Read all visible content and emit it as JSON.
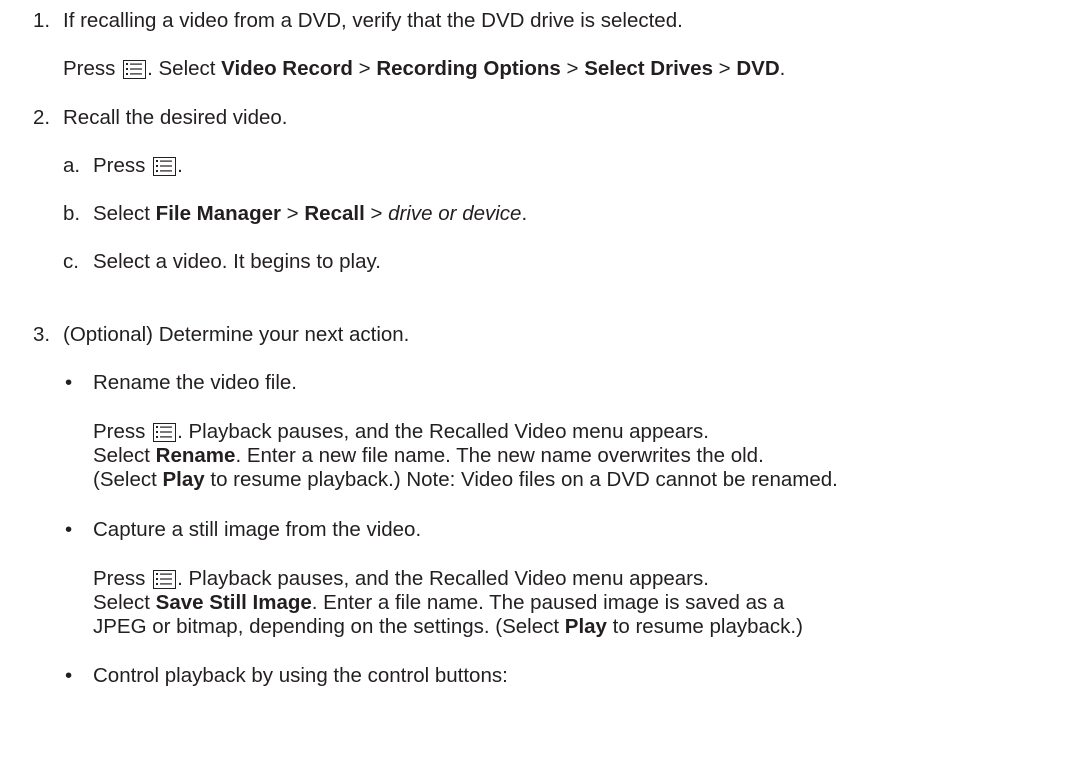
{
  "steps": [
    {
      "number": "1.",
      "text": "If recalling a video from a DVD, verify that the DVD drive is selected.",
      "body": {
        "press": "Press",
        "after_icon": ". Select ",
        "path": [
          "Video Record",
          "Recording Options",
          "Select Drives",
          "DVD"
        ],
        "sep": " > ",
        "end": "."
      }
    },
    {
      "number": "2.",
      "text": "Recall the desired video.",
      "substeps": [
        {
          "letter": "a.",
          "press": "Press",
          "end": "."
        },
        {
          "letter": "b.",
          "select": "Select ",
          "bold1": "File Manager",
          "sep": " > ",
          "bold2": "Recall",
          "italic": "drive or device",
          "end": "."
        },
        {
          "letter": "c.",
          "text": "Select a video. It begins to play."
        }
      ]
    },
    {
      "number": "3.",
      "text": "(Optional) Determine your next action.",
      "bullets": [
        {
          "bullet": "•",
          "title": "Rename the video file.",
          "line1_press": "Press",
          "line1_rest": ". Playback pauses, and the Recalled Video menu appears.",
          "line2_a": "Select ",
          "line2_bold": "Rename",
          "line2_b": ". Enter a new file name. The new name overwrites the old.",
          "line3_a": "(Select ",
          "line3_bold": "Play",
          "line3_b": " to resume playback.) Note: Video files on a DVD cannot be renamed."
        },
        {
          "bullet": "•",
          "title": "Capture a still image from the video.",
          "line1_press": "Press",
          "line1_rest": ". Playback pauses, and the Recalled Video menu appears.",
          "line2_a": "Select ",
          "line2_bold": "Save Still Image",
          "line2_b": ". Enter a file name. The paused image is saved as a",
          "line3_a": "JPEG or bitmap, depending on the settings. (Select ",
          "line3_bold": "Play",
          "line3_b": " to resume playback.)"
        },
        {
          "bullet": "•",
          "title": "Control playback by using the control buttons:"
        }
      ]
    }
  ],
  "icons": {
    "menu": "menu-button-icon"
  }
}
